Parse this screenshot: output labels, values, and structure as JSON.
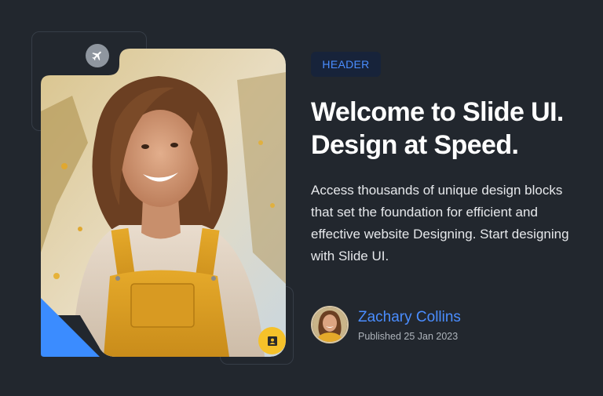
{
  "colors": {
    "background": "#22272e",
    "accent_blue": "#4a8dff",
    "accent_yellow": "#f5c12a",
    "chip_bg": "#17233a"
  },
  "hero": {
    "chip_label": "HEADER",
    "title": "Welcome to Slide UI. Design at Speed.",
    "description": "Access thousands of unique design blocks that set the foundation for efficient and effective website Designing. Start designing with Slide UI."
  },
  "author": {
    "name": "Zachary Collins",
    "published": "Published 25 Jan 2023"
  },
  "icons": {
    "top_badge": "airplane-icon",
    "bottom_badge": "contact-card-icon"
  }
}
